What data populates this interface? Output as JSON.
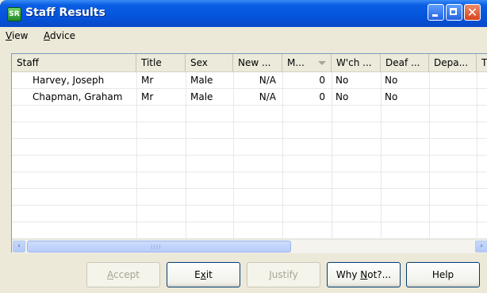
{
  "window": {
    "title": "Staff Results",
    "icon": "app-icon",
    "controls": [
      "minimize-icon",
      "maximize-icon",
      "close-icon"
    ]
  },
  "menu": {
    "items": [
      {
        "mnemonic": "V",
        "rest": "iew"
      },
      {
        "mnemonic": "A",
        "rest": "dvice"
      }
    ]
  },
  "table": {
    "columns": [
      "Staff",
      "Title",
      "Sex",
      "New ...",
      "M...",
      "W'ch ...",
      "Deaf ...",
      "Depa...",
      "T"
    ],
    "sorted_column": "M...",
    "rows": [
      [
        "Harvey, Joseph",
        "Mr",
        "Male",
        "N/A",
        "0",
        "No",
        "No",
        "",
        ""
      ],
      [
        "Chapman, Graham",
        "Mr",
        "Male",
        "N/A",
        "0",
        "No",
        "No",
        "",
        ""
      ]
    ]
  },
  "scrollbar": {
    "left_arrow": "‹",
    "right_arrow": "›",
    "grip": "IIII"
  },
  "buttons": [
    {
      "name": "accept",
      "pre": "",
      "mnemonic": "A",
      "post": "ccept",
      "enabled": false
    },
    {
      "name": "exit",
      "pre": "E",
      "mnemonic": "x",
      "post": "it",
      "enabled": true
    },
    {
      "name": "justify",
      "pre": "",
      "mnemonic": "J",
      "post": "ustify",
      "enabled": false
    },
    {
      "name": "why-not",
      "pre": "Why ",
      "mnemonic": "N",
      "post": "ot?...",
      "enabled": true
    },
    {
      "name": "help",
      "pre": "",
      "mnemonic": "",
      "post": "Help",
      "enabled": true
    }
  ],
  "colors": {
    "titlebar": "#0454dc",
    "grid_border": "#7f9db9",
    "disabled_text": "#a6a596"
  }
}
